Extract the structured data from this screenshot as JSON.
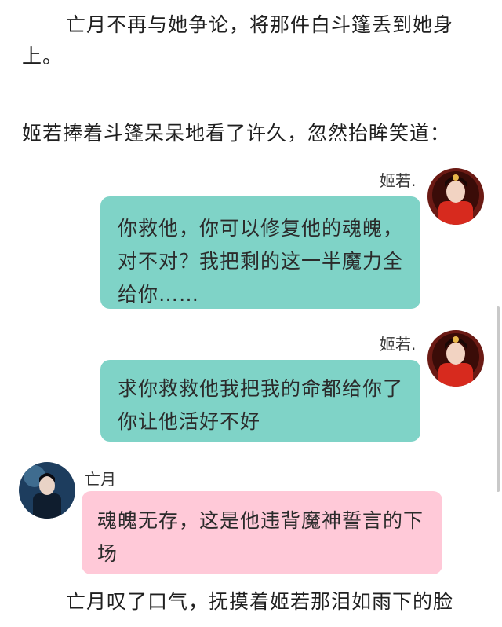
{
  "narration": {
    "p1": "亡月不再与她争论，将那件白斗篷丢到她身上。",
    "p2": "姬若捧着斗篷呆呆地看了许久，忽然抬眸笑道：",
    "p3": "亡月叹了口气，抚摸着姬若那泪如雨下的脸"
  },
  "chat": {
    "messages": [
      {
        "sender": "姬若.",
        "text": "你救他，你可以修复他的魂魄，对不对？我把剩的这一半魔力全给你……"
      },
      {
        "sender": "姬若.",
        "text": "求你救救他我把我的命都给你了你让他活好不好"
      },
      {
        "sender": "亡月",
        "text": "魂魄无存，这是他违背魔神誓言的下场"
      }
    ]
  },
  "colors": {
    "bubble_right": "#7fd3c7",
    "bubble_left": "#ffc9d8"
  },
  "icons": {
    "avatar_right": "avatar-red-dress-woman",
    "avatar_left": "avatar-dark-robed-man"
  }
}
